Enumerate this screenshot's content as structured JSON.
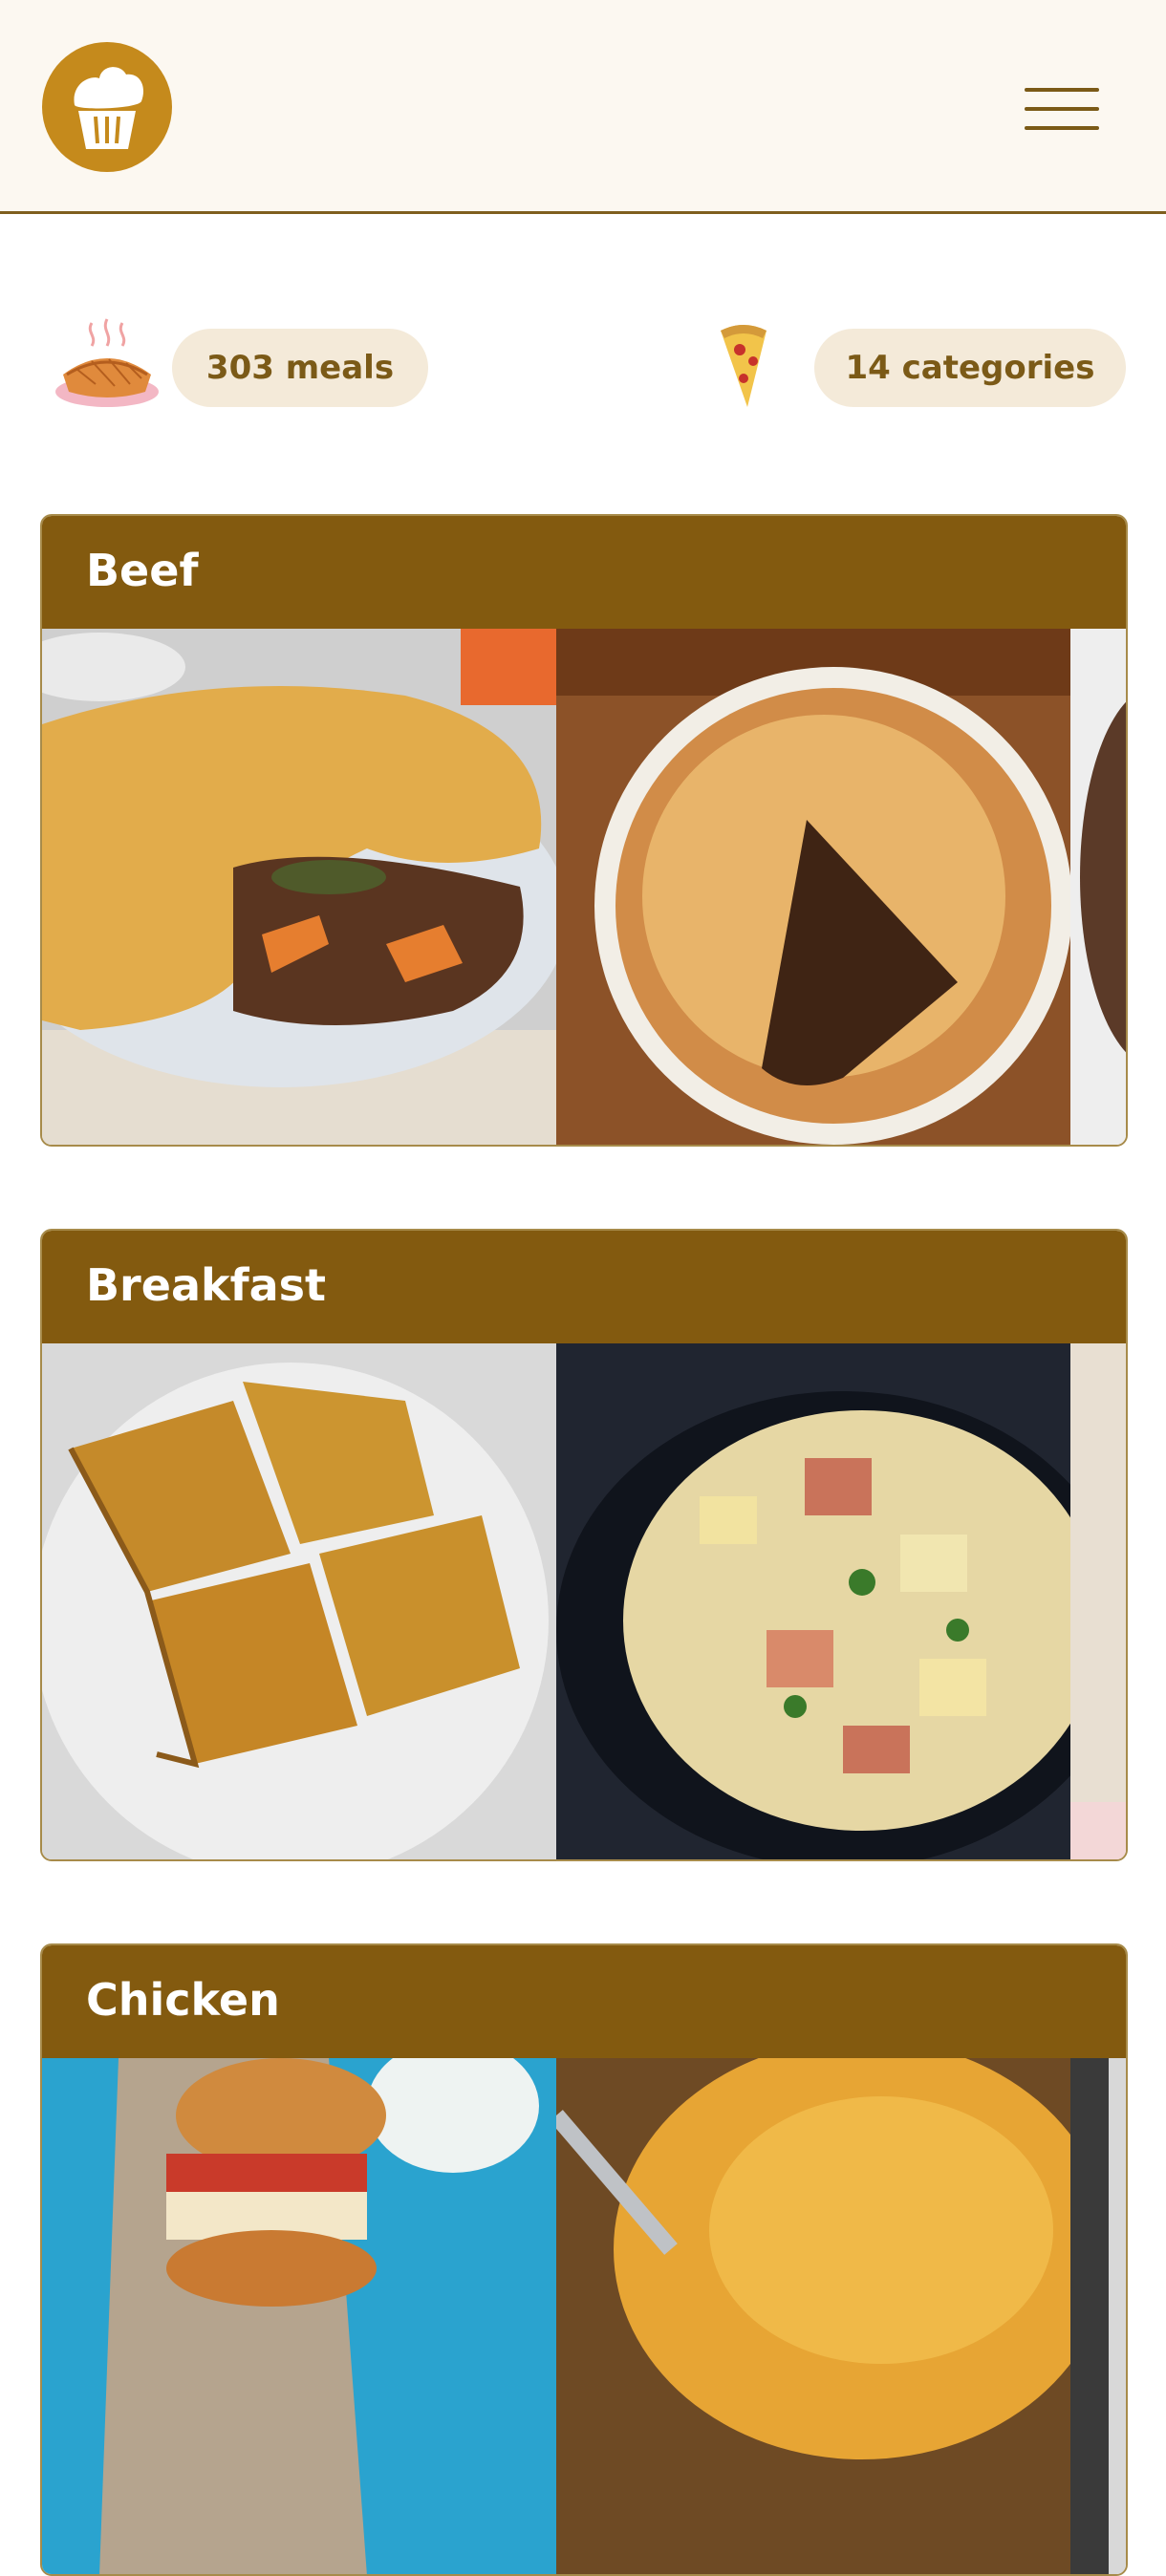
{
  "header": {
    "logo_icon": "cupcake-icon",
    "menu_icon": "hamburger-menu-icon"
  },
  "stats": {
    "meals_icon": "pie-icon",
    "meals": "303 meals",
    "categories_icon": "pizza-slice-icon",
    "categories": "14 categories"
  },
  "categories": [
    {
      "name": "Beef",
      "photos": [
        "beef-pie-photo",
        "beef-pie-sliced-photo",
        "beef-stew-photo"
      ]
    },
    {
      "name": "Breakfast",
      "photos": [
        "french-toast-photo",
        "potato-skillet-photo",
        "pastry-photo"
      ]
    },
    {
      "name": "Chicken",
      "photos": [
        "chicken-burger-photo",
        "cheesy-chicken-photo",
        "chicken-dish-photo"
      ]
    }
  ],
  "colors": {
    "brand": "#c58a1c",
    "card_header": "#835a0f",
    "pill_bg": "#f4ead9",
    "pill_text": "#7b5a17",
    "header_bg": "#fcf8f1"
  }
}
